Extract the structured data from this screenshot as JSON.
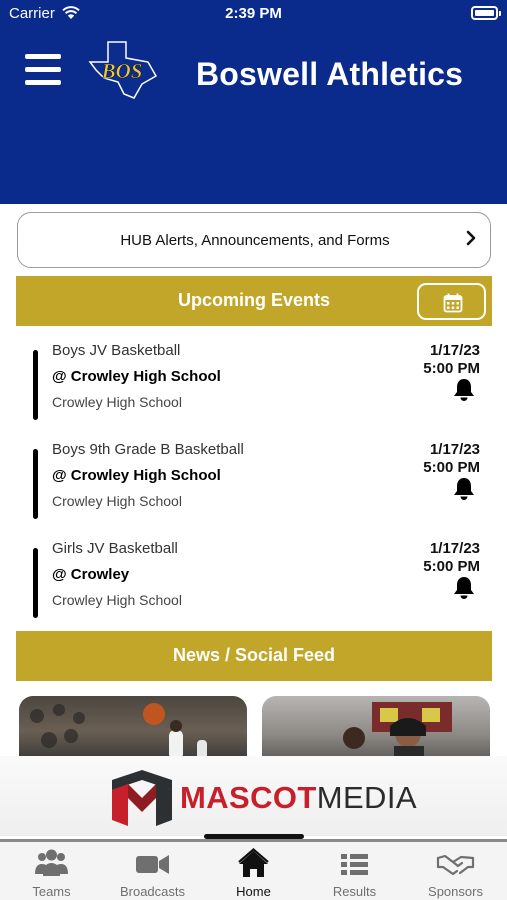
{
  "status_bar": {
    "carrier": "Carrier",
    "time": "2:39 PM"
  },
  "header": {
    "title": "Boswell Athletics",
    "logo_text": "BOS",
    "bg_color": "#0a2a8c"
  },
  "hub_link": {
    "label": "HUB Alerts, Announcements, and Forms"
  },
  "upcoming": {
    "title": "Upcoming Events",
    "events": [
      {
        "sport": "Boys JV Basketball",
        "opponent": "@ Crowley High School",
        "venue": "Crowley High School",
        "date": "1/17/23",
        "time": "5:00 PM"
      },
      {
        "sport": "Boys 9th Grade B Basketball",
        "opponent": "@ Crowley High School",
        "venue": "Crowley High School",
        "date": "1/17/23",
        "time": "5:00 PM"
      },
      {
        "sport": "Girls JV Basketball",
        "opponent": "@ Crowley",
        "venue": "Crowley High School",
        "date": "1/17/23",
        "time": "5:00 PM"
      }
    ]
  },
  "news": {
    "title": "News / Social Feed"
  },
  "sponsor": {
    "name_part1": "MASCOT",
    "name_part2": "MEDIA"
  },
  "tabs": [
    {
      "label": "Teams",
      "icon": "people-icon"
    },
    {
      "label": "Broadcasts",
      "icon": "video-camera-icon"
    },
    {
      "label": "Home",
      "icon": "home-icon",
      "active": true
    },
    {
      "label": "Results",
      "icon": "list-icon"
    },
    {
      "label": "Sponsors",
      "icon": "handshake-icon"
    }
  ],
  "colors": {
    "gold": "#c2a62a",
    "navy": "#0a2a8c",
    "tab_inactive": "#6f6f6f",
    "mascot_red": "#c8202a"
  }
}
